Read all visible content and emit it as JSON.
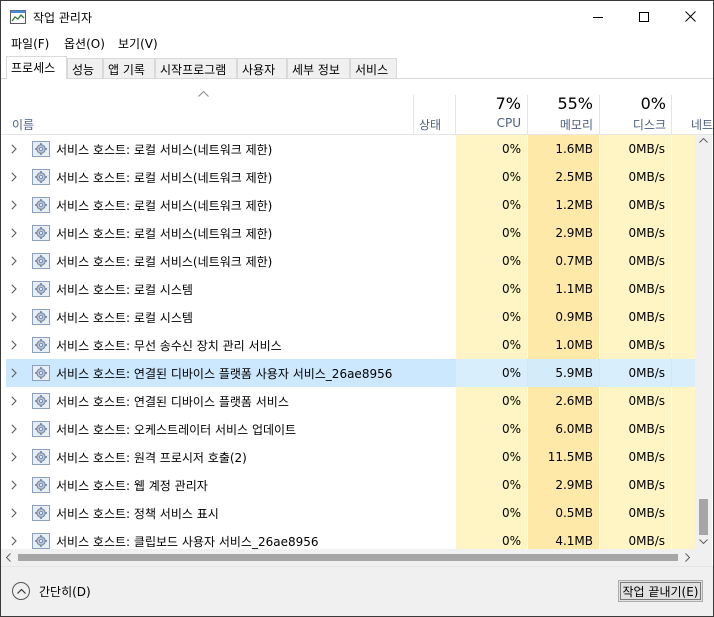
{
  "window": {
    "title": "작업 관리자",
    "buttons": {
      "minimize": "minimize-icon",
      "maximize": "maximize-icon",
      "close": "close-icon"
    }
  },
  "menu": [
    {
      "label": "파일(F)"
    },
    {
      "label": "옵션(O)"
    },
    {
      "label": "보기(V)"
    }
  ],
  "tabs": [
    {
      "label": "프로세스",
      "active": true
    },
    {
      "label": "성능"
    },
    {
      "label": "앱 기록"
    },
    {
      "label": "시작프로그램"
    },
    {
      "label": "사용자"
    },
    {
      "label": "세부 정보"
    },
    {
      "label": "서비스"
    }
  ],
  "columns": {
    "name": "이름",
    "status": "상태",
    "cpu": {
      "percent": "7%",
      "label": "CPU"
    },
    "memory": {
      "percent": "55%",
      "label": "메모리"
    },
    "disk": {
      "percent": "0%",
      "label": "디스크"
    },
    "network": {
      "label": "네트"
    }
  },
  "processes": [
    {
      "name": "서비스 호스트: 로컬 서비스(네트워크 제한)",
      "cpu": "0%",
      "memory": "1.6MB",
      "disk": "0MB/s"
    },
    {
      "name": "서비스 호스트: 로컬 서비스(네트워크 제한)",
      "cpu": "0%",
      "memory": "2.5MB",
      "disk": "0MB/s"
    },
    {
      "name": "서비스 호스트: 로컬 서비스(네트워크 제한)",
      "cpu": "0%",
      "memory": "1.2MB",
      "disk": "0MB/s"
    },
    {
      "name": "서비스 호스트: 로컬 서비스(네트워크 제한)",
      "cpu": "0%",
      "memory": "2.9MB",
      "disk": "0MB/s"
    },
    {
      "name": "서비스 호스트: 로컬 서비스(네트워크 제한)",
      "cpu": "0%",
      "memory": "0.7MB",
      "disk": "0MB/s"
    },
    {
      "name": "서비스 호스트: 로컬 시스템",
      "cpu": "0%",
      "memory": "1.1MB",
      "disk": "0MB/s"
    },
    {
      "name": "서비스 호스트: 로컬 시스템",
      "cpu": "0%",
      "memory": "0.9MB",
      "disk": "0MB/s"
    },
    {
      "name": "서비스 호스트: 무선 송수신 장치 관리 서비스",
      "cpu": "0%",
      "memory": "1.0MB",
      "disk": "0MB/s"
    },
    {
      "name": "서비스 호스트: 연결된 디바이스 플랫폼 사용자 서비스_26ae8956",
      "cpu": "0%",
      "memory": "5.9MB",
      "disk": "0MB/s",
      "selected": true
    },
    {
      "name": "서비스 호스트: 연결된 디바이스 플랫폼 서비스",
      "cpu": "0%",
      "memory": "2.6MB",
      "disk": "0MB/s"
    },
    {
      "name": "서비스 호스트: 오케스트레이터 서비스 업데이트",
      "cpu": "0%",
      "memory": "6.0MB",
      "disk": "0MB/s"
    },
    {
      "name": "서비스 호스트: 원격 프로시저 호출(2)",
      "cpu": "0%",
      "memory": "11.5MB",
      "disk": "0MB/s"
    },
    {
      "name": "서비스 호스트: 웹 계정 관리자",
      "cpu": "0%",
      "memory": "2.9MB",
      "disk": "0MB/s"
    },
    {
      "name": "서비스 호스트: 정책 서비스 표시",
      "cpu": "0%",
      "memory": "0.5MB",
      "disk": "0MB/s"
    },
    {
      "name": "서비스 호스트: 클립보드 사용자 서비스_26ae8956",
      "cpu": "0%",
      "memory": "4.1MB",
      "disk": "0MB/s"
    }
  ],
  "footer": {
    "fewer_details": "간단히(D)",
    "end_task": "작업 끝내기(E)"
  },
  "colors": {
    "header_text": "#4d6082",
    "heat_light": "#fff4c4",
    "heat_medium": "#ffe9a8",
    "selection": "#cce8ff"
  }
}
